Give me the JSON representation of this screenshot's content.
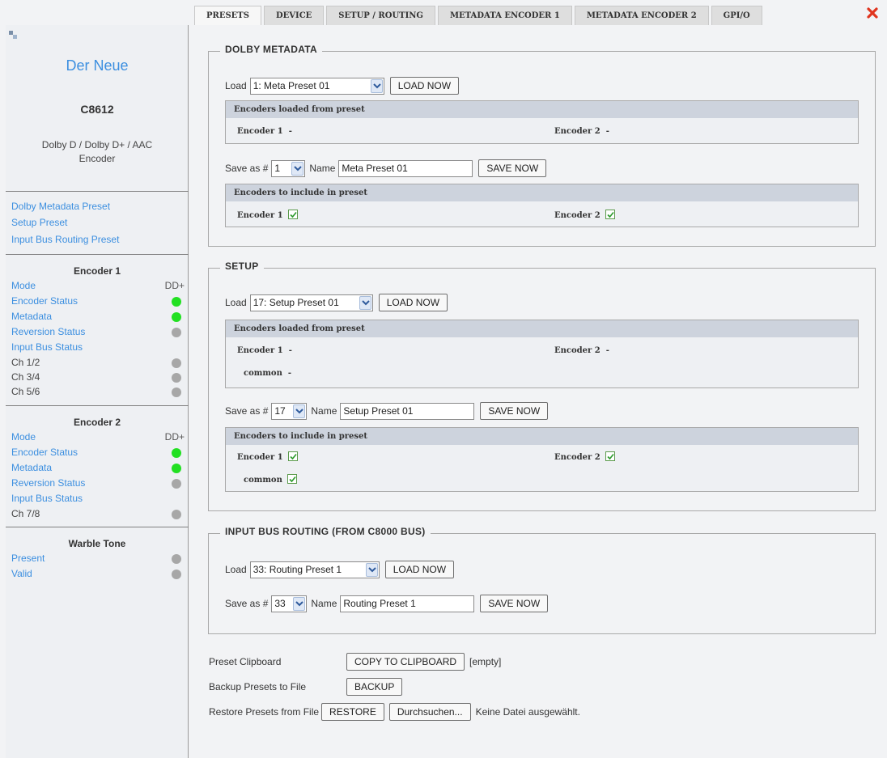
{
  "tabs": [
    {
      "label": "PRESETS",
      "active": true
    },
    {
      "label": "DEVICE",
      "active": false
    },
    {
      "label": "SETUP / ROUTING",
      "active": false
    },
    {
      "label": "METADATA ENCODER 1",
      "active": false
    },
    {
      "label": "METADATA ENCODER 2",
      "active": false
    },
    {
      "label": "GPI/O",
      "active": false
    }
  ],
  "sidebar": {
    "device_name": "Der Neue",
    "model": "C8612",
    "description": "Dolby D / Dolby D+ / AAC Encoder",
    "links": [
      "Dolby Metadata Preset",
      "Setup Preset",
      "Input Bus Routing Preset"
    ],
    "encoder1": {
      "title": "Encoder 1",
      "mode_label": "Mode",
      "mode_value": "DD+",
      "encoder_status": "Encoder Status",
      "metadata": "Metadata",
      "reversion_status": "Reversion Status",
      "input_bus_status": "Input Bus Status",
      "ch12": "Ch 1/2",
      "ch34": "Ch 3/4",
      "ch56": "Ch 5/6"
    },
    "encoder2": {
      "title": "Encoder 2",
      "mode_label": "Mode",
      "mode_value": "DD+",
      "encoder_status": "Encoder Status",
      "metadata": "Metadata",
      "reversion_status": "Reversion Status",
      "input_bus_status": "Input Bus Status",
      "ch78": "Ch 7/8"
    },
    "warble": {
      "title": "Warble Tone",
      "present": "Present",
      "valid": "Valid"
    }
  },
  "common": {
    "load_label": "Load",
    "load_now": "LOAD NOW",
    "save_as": "Save as #",
    "name_label": "Name",
    "save_now": "SAVE NOW",
    "loaded_header": "Encoders loaded from preset",
    "include_header": "Encoders to include in preset",
    "encoder1": "Encoder 1",
    "encoder2": "Encoder 2",
    "common_label": "common",
    "dash": "-"
  },
  "dolby": {
    "title": "DOLBY METADATA",
    "load_value": "1: Meta Preset 01",
    "save_number": "1",
    "name_value": "Meta Preset 01",
    "include_enc1": true,
    "include_enc2": true
  },
  "setup": {
    "title": "SETUP",
    "load_value": "17: Setup Preset 01",
    "save_number": "17",
    "name_value": "Setup Preset 01",
    "include_enc1": true,
    "include_enc2": true,
    "include_common": true
  },
  "routing": {
    "title": "INPUT BUS ROUTING (FROM C8000 BUS)",
    "load_value": "33: Routing Preset 1",
    "save_number": "33",
    "name_value": "Routing Preset 1"
  },
  "bottom": {
    "clipboard_label": "Preset Clipboard",
    "copy_button": "COPY TO CLIPBOARD",
    "clipboard_state": "[empty]",
    "backup_label": "Backup Presets to File",
    "backup_button": "BACKUP",
    "restore_label": "Restore Presets from File",
    "restore_button": "RESTORE",
    "browse_button": "Durchsuchen...",
    "no_file": "Keine Datei ausgewählt."
  },
  "colors": {
    "accent": "#3c8fe0",
    "status_ok": "#22e022",
    "status_off": "#a7a7a7",
    "close": "#e0341e"
  }
}
